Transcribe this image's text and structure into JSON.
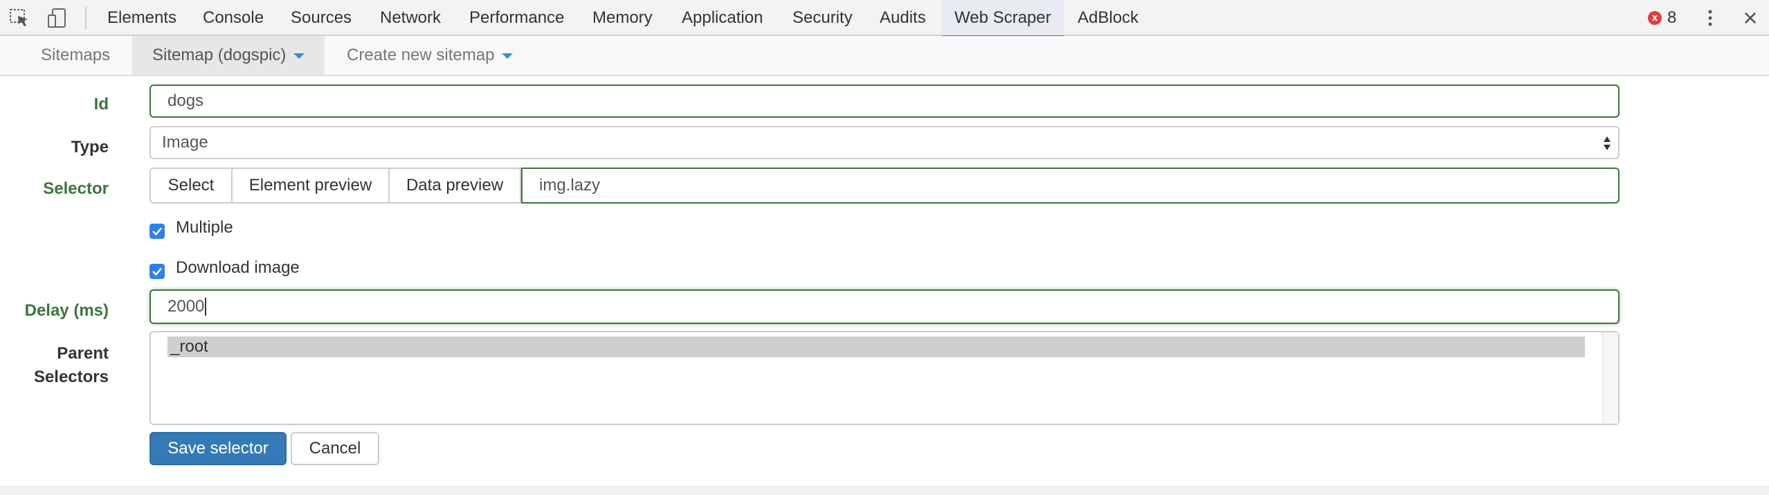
{
  "devtools": {
    "tabs": [
      "Elements",
      "Console",
      "Sources",
      "Network",
      "Performance",
      "Memory",
      "Application",
      "Security",
      "Audits",
      "Web Scraper",
      "AdBlock"
    ],
    "active_tab": "Web Scraper",
    "error_count": "8",
    "error_icon": "x",
    "close_icon": "×",
    "inspect_icon": "inspect-element-icon",
    "device_icon": "device-toolbar-icon",
    "accent_color": "#1a73e8"
  },
  "scraper_nav": {
    "sitemaps": "Sitemaps",
    "current_sitemap": "Sitemap (dogspic)",
    "create_new": "Create new sitemap"
  },
  "form": {
    "id_label": "Id",
    "id_value": "dogs",
    "type_label": "Type",
    "type_value": "Image",
    "selector_label": "Selector",
    "select_button": "Select",
    "element_preview_button": "Element preview",
    "data_preview_button": "Data preview",
    "selector_value": "img.lazy",
    "multiple_label": "Multiple",
    "multiple_checked": true,
    "download_label": "Download image",
    "download_checked": true,
    "delay_label": "Delay (ms)",
    "delay_value": "2000",
    "parent_label_line1": "Parent",
    "parent_label_line2": "Selectors",
    "parent_options": [
      "_root"
    ],
    "save_button": "Save selector",
    "cancel_button": "Cancel",
    "valid_color": "#3c763d",
    "primary_color": "#337ab7"
  }
}
